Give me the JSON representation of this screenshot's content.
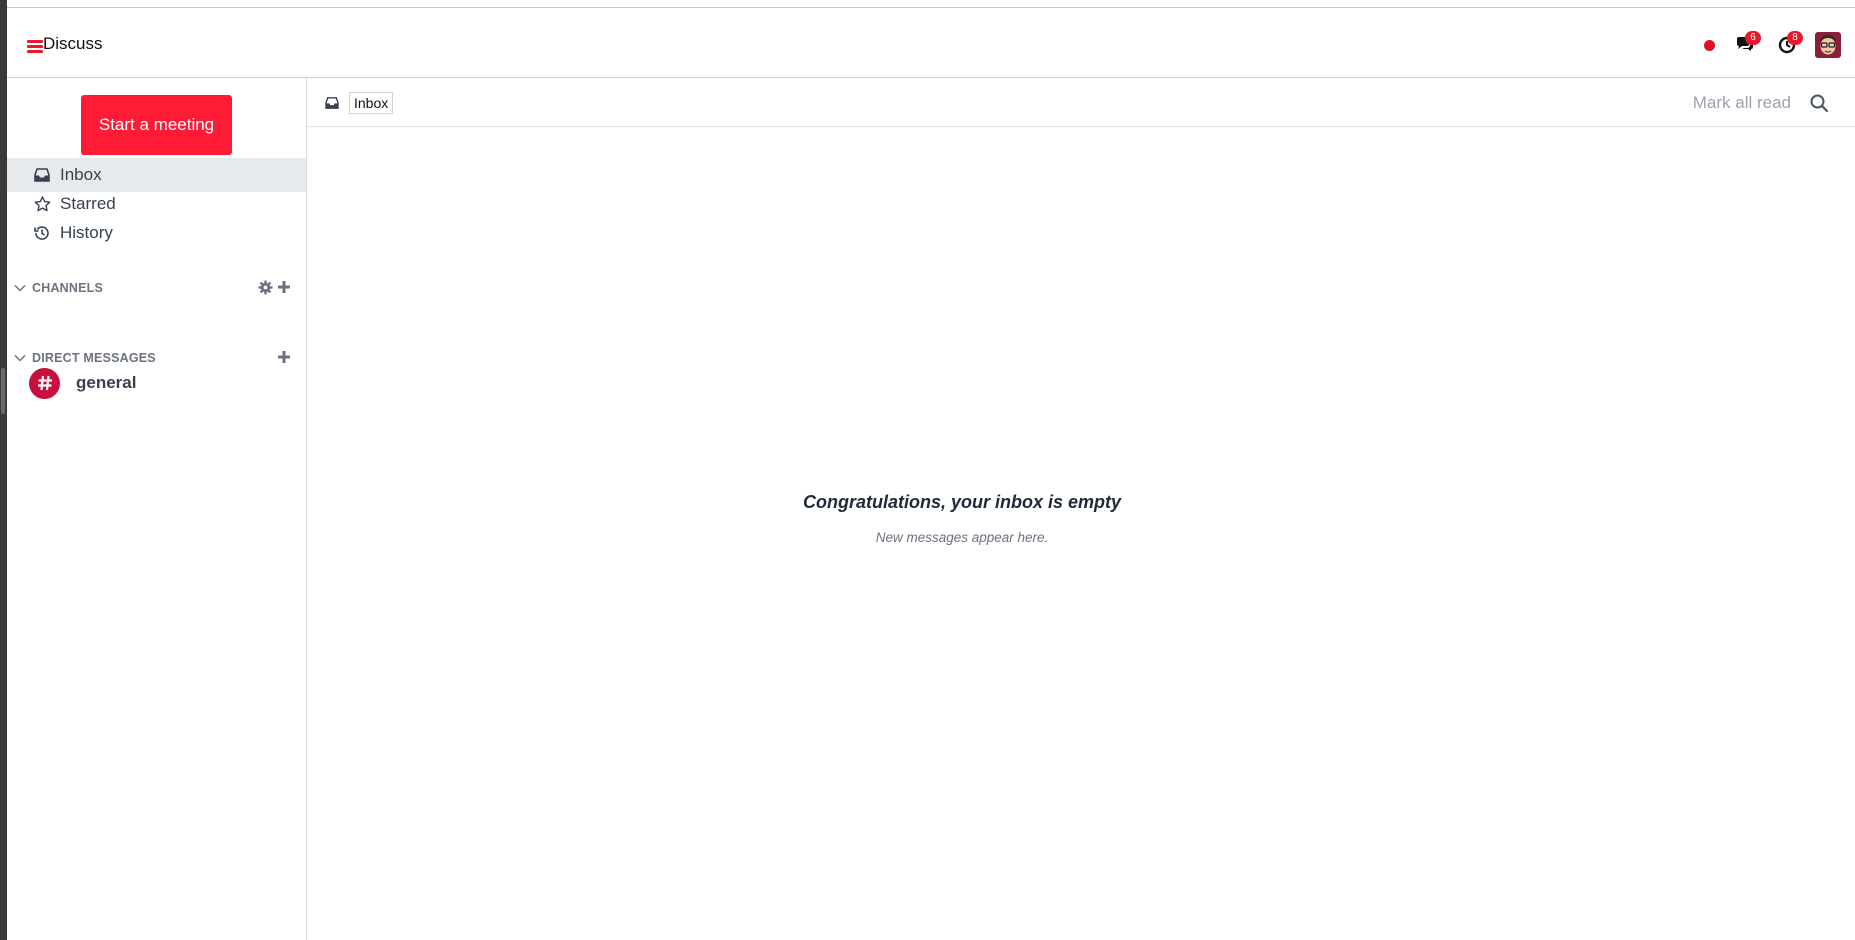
{
  "navbar": {
    "app_title": "Discuss",
    "messages_badge": "6",
    "activities_badge": "8"
  },
  "sidebar": {
    "start_meeting_label": "Start a meeting",
    "mailboxes": [
      {
        "label": "Inbox",
        "icon": "inbox-icon"
      },
      {
        "label": "Starred",
        "icon": "star-icon"
      },
      {
        "label": "History",
        "icon": "history-icon"
      }
    ],
    "channels_header": "CHANNELS",
    "channels": [
      {
        "name": "general"
      }
    ],
    "direct_messages_header": "DIRECT MESSAGES"
  },
  "main": {
    "toolbar_label": "Inbox",
    "mark_all_read_label": "Mark all read",
    "empty_title": "Congratulations, your inbox is empty",
    "empty_subtitle": "New messages appear here."
  },
  "colors": {
    "accent": "#ff1a35",
    "badge": "#e8192c",
    "channel_avatar": "#c8103e",
    "active_item_bg": "#e7eaed"
  }
}
